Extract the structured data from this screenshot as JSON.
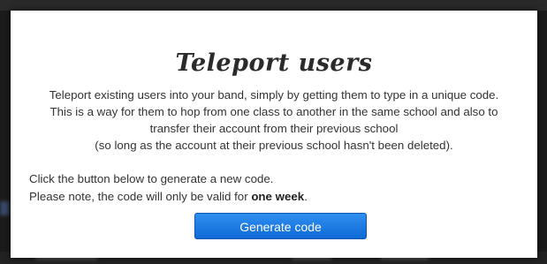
{
  "modal": {
    "title": "Teleport users",
    "intro_lines": [
      "Teleport existing users into your band, simply by getting them to type in a unique code.",
      "This is a way for them to hop from one class to another in the same school and also to",
      "transfer their account from their previous school",
      "(so long as the account at their previous school hasn't been deleted)."
    ],
    "instruction": "Click the button below to generate a new code.",
    "validity_prefix": "Please note, the code will only be valid for ",
    "validity_emphasis": "one week",
    "validity_suffix": ".",
    "button_label": "Generate code"
  },
  "colors": {
    "button_top": "#2f8ff0",
    "button_bottom": "#0f6ad6",
    "overlay": "#1b1b1b"
  }
}
